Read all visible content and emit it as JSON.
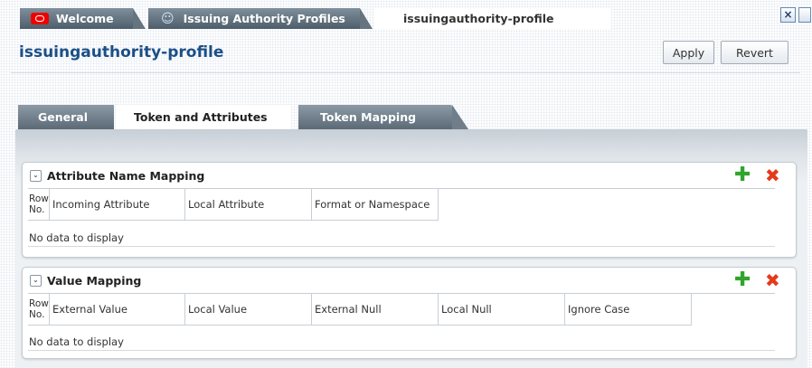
{
  "doc_tabs": [
    {
      "label": "Welcome",
      "icon": "oracle-logo-icon"
    },
    {
      "label": "Issuing Authority Profiles",
      "icon": "people-icon"
    },
    {
      "label": "issuingauthority-profile",
      "active": true
    }
  ],
  "header": {
    "title": "issuingauthority-profile",
    "apply": "Apply",
    "revert": "Revert"
  },
  "inner_tabs": [
    "General",
    "Token and Attributes",
    "Token Mapping"
  ],
  "attribute_mapping": {
    "title": "Attribute Name Mapping",
    "columns": [
      "Row No.",
      "Incoming Attribute",
      "Local Attribute",
      "Format or Namespace"
    ],
    "empty": "No data to display"
  },
  "value_mapping": {
    "title": "Value Mapping",
    "columns": [
      "Row No.",
      "External Value",
      "Local Value",
      "External Null",
      "Local Null",
      "Ignore Case"
    ],
    "empty": "No data to display"
  },
  "colors": {
    "title_blue": "#1b4f87",
    "add_green": "#2fa52c",
    "delete_red": "#e53a1b"
  }
}
